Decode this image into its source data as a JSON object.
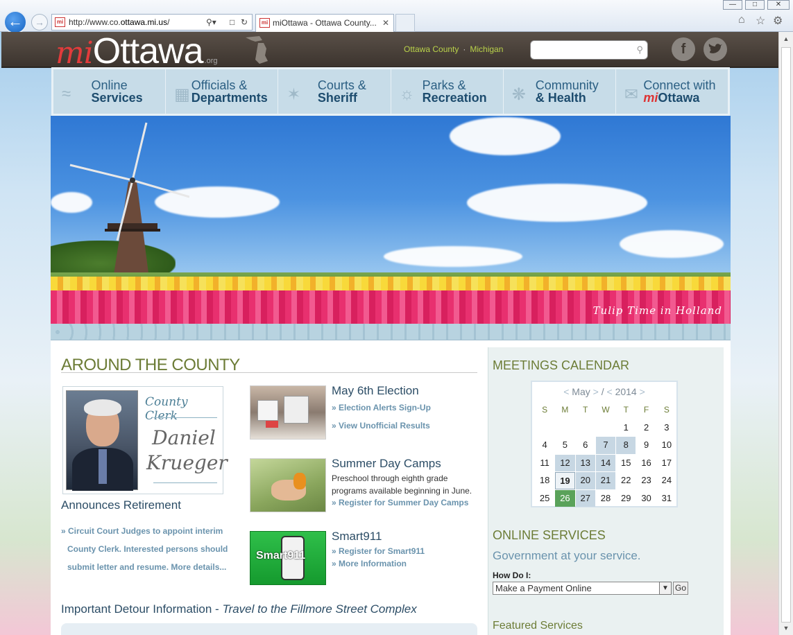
{
  "browser": {
    "url_prefix": "http://www.co.",
    "url_domain": "ottawa.mi.us",
    "url_suffix": "/",
    "tab_title": "miOttawa - Ottawa County...",
    "fav_text": "mi"
  },
  "site": {
    "logo_mi": "mi",
    "logo_name": "Ottawa",
    "logo_org": ".org",
    "location_county": "Ottawa County",
    "location_state": "Michigan",
    "search_placeholder": ""
  },
  "nav": [
    {
      "line1": "Online",
      "line2": "Services"
    },
    {
      "line1": "Officials &",
      "line2": "Departments"
    },
    {
      "line1": "Courts &",
      "line2": "Sheriff"
    },
    {
      "line1": "Parks &",
      "line2": "Recreation"
    },
    {
      "line1": "Community",
      "line2": "& Health"
    },
    {
      "line1": "Connect with",
      "line2_mi": "mi",
      "line2": "Ottawa"
    }
  ],
  "hero": {
    "caption": "Tulip Time in Holland"
  },
  "around": {
    "heading": "AROUND THE COUNTY",
    "clerk_label": "County Clerk",
    "clerk_name_1": "Daniel",
    "clerk_name_2": "Krueger",
    "announce": "Announces Retirement",
    "bullets": [
      "» Circuit Court Judges to appoint interim",
      "County Clerk. Interested persons should",
      "submit letter and resume. More details..."
    ]
  },
  "news": [
    {
      "title": "May 6th Election",
      "links": [
        "» Election Alerts Sign-Up",
        "» View Unofficial Results"
      ]
    },
    {
      "title": "Summer Day Camps",
      "text_1": "Preschool through eighth grade",
      "text_2": "programs available beginning in June.",
      "links": [
        "» Register for Summer Day Camps"
      ]
    },
    {
      "title": "Smart911",
      "links": [
        "» Register for Smart911",
        "» More Information"
      ],
      "badge": "Smart911"
    }
  ],
  "detour": {
    "title": "Important Detour Information - ",
    "subtitle": "Travel to the Fillmore Street Complex"
  },
  "meetings": {
    "heading": "MEETINGS CALENDAR",
    "month": "May",
    "year": "2014",
    "weekdays": [
      "S",
      "M",
      "T",
      "W",
      "T",
      "F",
      "S"
    ],
    "days": [
      "",
      "",
      "",
      "",
      "1",
      "2",
      "3",
      "4",
      "5",
      "6",
      "7",
      "8",
      "9",
      "10",
      "11",
      "12",
      "13",
      "14",
      "15",
      "16",
      "17",
      "18",
      "19",
      "20",
      "21",
      "22",
      "23",
      "24",
      "25",
      "26",
      "27",
      "28",
      "29",
      "30",
      "31"
    ],
    "event_days": [
      "7",
      "8",
      "12",
      "13",
      "14",
      "20",
      "21",
      "27"
    ],
    "today": "19",
    "selected": "26"
  },
  "online": {
    "heading": "ONLINE SERVICES",
    "tagline": "Government at your service.",
    "how_label": "How Do I:",
    "select_value": "Make a Payment Online",
    "go_label": "Go",
    "featured": "Featured Services"
  },
  "colors": {
    "accent_green": "#6c7c36",
    "link_blue": "#6a93ad",
    "nav_bg": "#c7dce8"
  }
}
